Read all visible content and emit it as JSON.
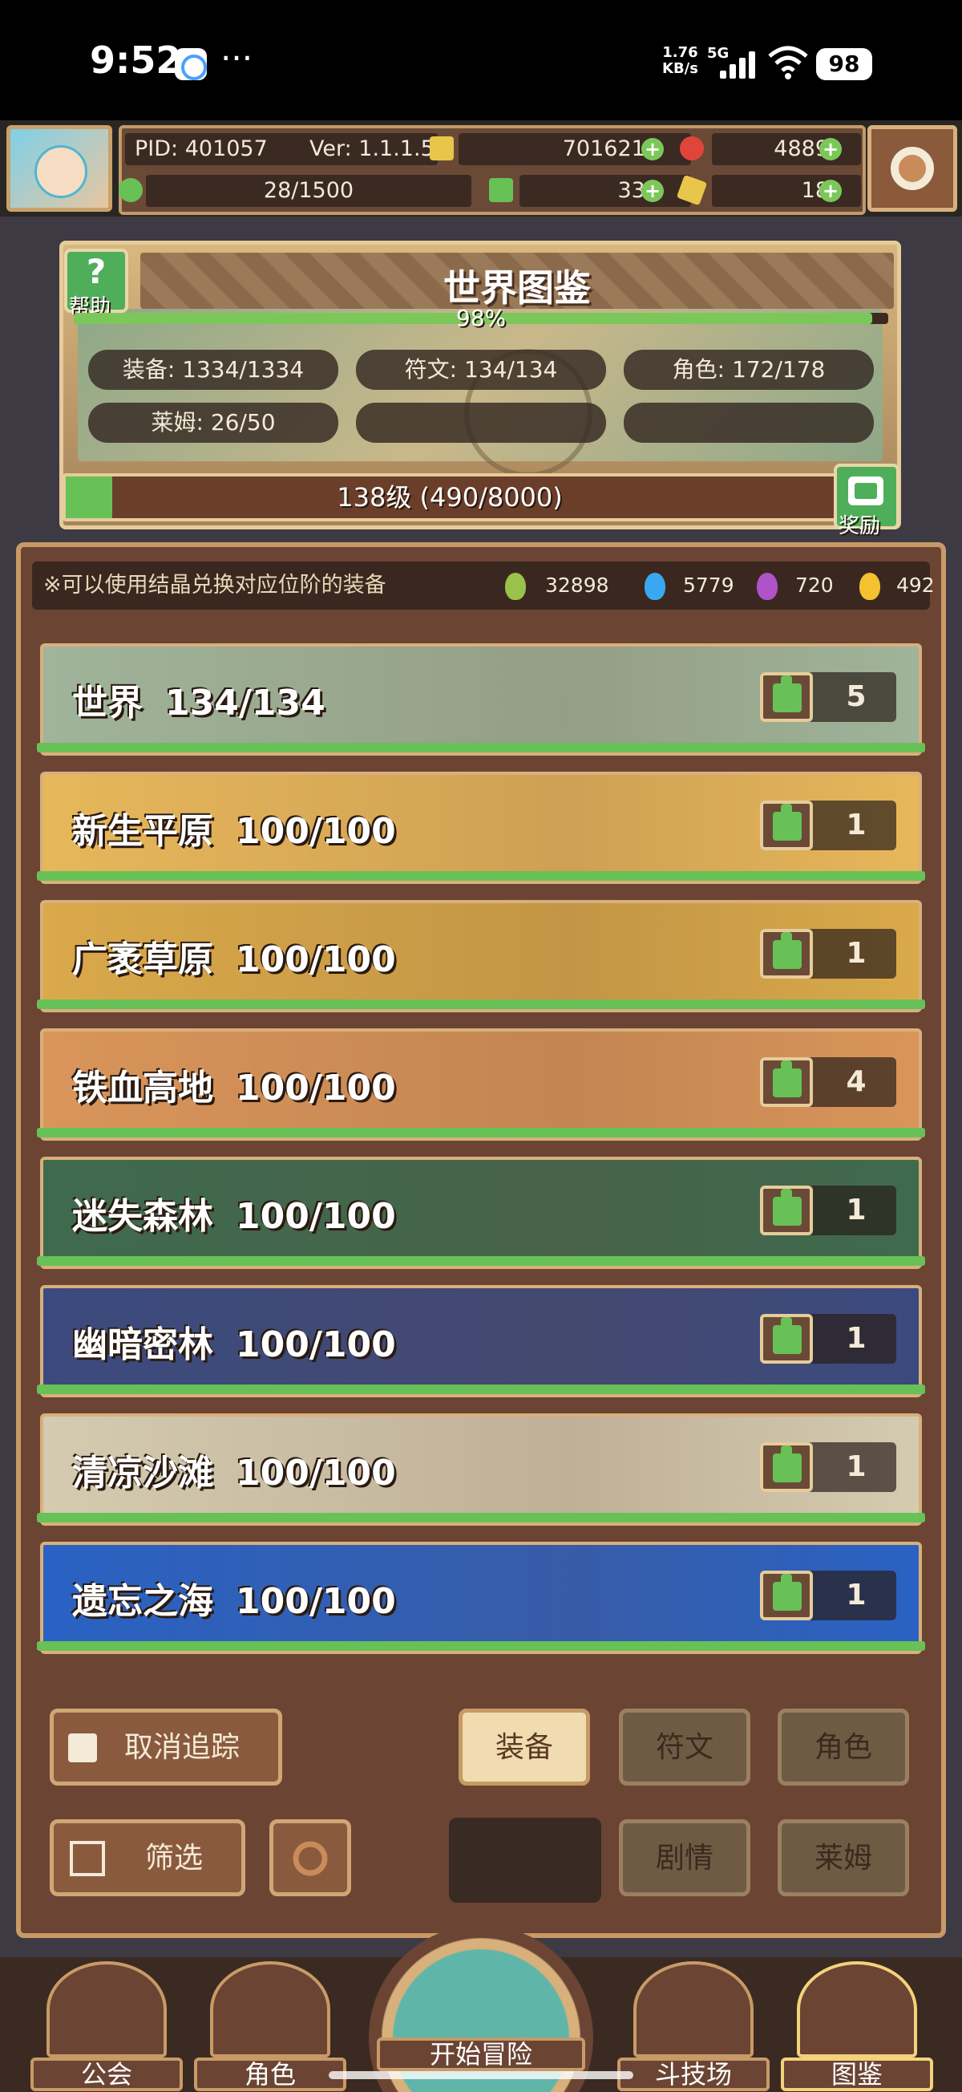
{
  "status_bar": {
    "time": "9:52",
    "dots": "···",
    "net_speed_value": "1.76",
    "net_speed_unit": "KB/s",
    "network": "5G",
    "battery": "98"
  },
  "player": {
    "pid": "PID: 401057",
    "version": "Ver: 1.1.1.5",
    "exp": "28/1500",
    "coins": "7016217",
    "gems": "4889",
    "clover": "331",
    "keys": "18"
  },
  "encyclopedia": {
    "title": "世界图鉴",
    "help_label": "帮助",
    "help_icon": "?",
    "completion": "98%",
    "completion_value": 0.98,
    "stats": {
      "equipment": "装备: 1334/1334",
      "runes": "符文: 134/134",
      "characters": "角色: 172/178",
      "slimes": "莱姆: 26/50"
    },
    "level_text": "138级 (490/8000)",
    "level_progress": 0.061,
    "reward_label": "奖励"
  },
  "notice": {
    "text": "※可以使用结晶兑换对应位阶的装备",
    "crystals": [
      {
        "color": "#9ac24a",
        "count": "32898"
      },
      {
        "color": "#3aa8f0",
        "count": "5779"
      },
      {
        "color": "#b052c8",
        "count": "720"
      },
      {
        "color": "#f2c230",
        "count": "492"
      }
    ]
  },
  "regions": [
    {
      "name": "世界",
      "progress": "134/134",
      "likes": "5",
      "bg": "#9fb49a"
    },
    {
      "name": "新生平原",
      "progress": "100/100",
      "likes": "1",
      "bg": "#e7b75b"
    },
    {
      "name": "广袤草原",
      "progress": "100/100",
      "likes": "1",
      "bg": "#d9a94a"
    },
    {
      "name": "铁血高地",
      "progress": "100/100",
      "likes": "4",
      "bg": "#d9955a"
    },
    {
      "name": "迷失森林",
      "progress": "100/100",
      "likes": "1",
      "bg": "#3f6a4e"
    },
    {
      "name": "幽暗密林",
      "progress": "100/100",
      "likes": "1",
      "bg": "#3b4a7e"
    },
    {
      "name": "清凉沙滩",
      "progress": "100/100",
      "likes": "1",
      "bg": "#d4cbb0"
    },
    {
      "name": "遗忘之海",
      "progress": "100/100",
      "likes": "1",
      "bg": "#2a62c4"
    }
  ],
  "controls": {
    "untrack": "取消追踪",
    "filter": "筛选",
    "tab_equipment": "装备",
    "tab_runes": "符文",
    "tab_characters": "角色",
    "tab_story": "剧情",
    "tab_slimes": "莱姆"
  },
  "nav": {
    "guild": "公会",
    "character": "角色",
    "adventure": "开始冒险",
    "arena": "斗技场",
    "encyclopedia": "图鉴"
  }
}
